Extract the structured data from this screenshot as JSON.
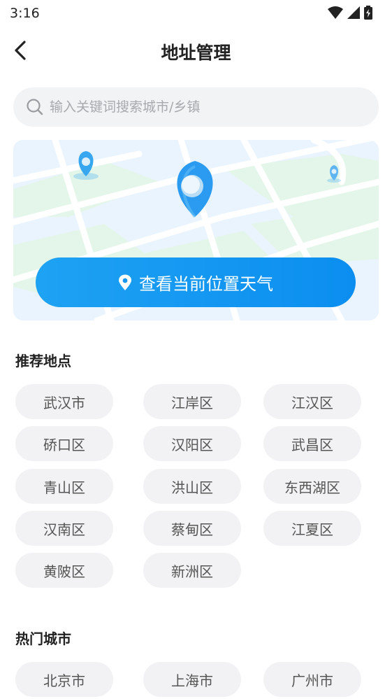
{
  "status": {
    "time": "3:16"
  },
  "header": {
    "title": "地址管理"
  },
  "search": {
    "placeholder": "输入关键词搜索城市/乡镇"
  },
  "map": {
    "button_label": "查看当前位置天气",
    "accent_color": "#1a9cf2"
  },
  "recommended": {
    "title": "推荐地点",
    "items": [
      "武汉市",
      "江岸区",
      "江汉区",
      "硚口区",
      "汉阳区",
      "武昌区",
      "青山区",
      "洪山区",
      "东西湖区",
      "汉南区",
      "蔡甸区",
      "江夏区",
      "黄陂区",
      "新洲区"
    ]
  },
  "hot": {
    "title": "热门城市",
    "items": [
      "北京市",
      "上海市",
      "广州市"
    ]
  }
}
